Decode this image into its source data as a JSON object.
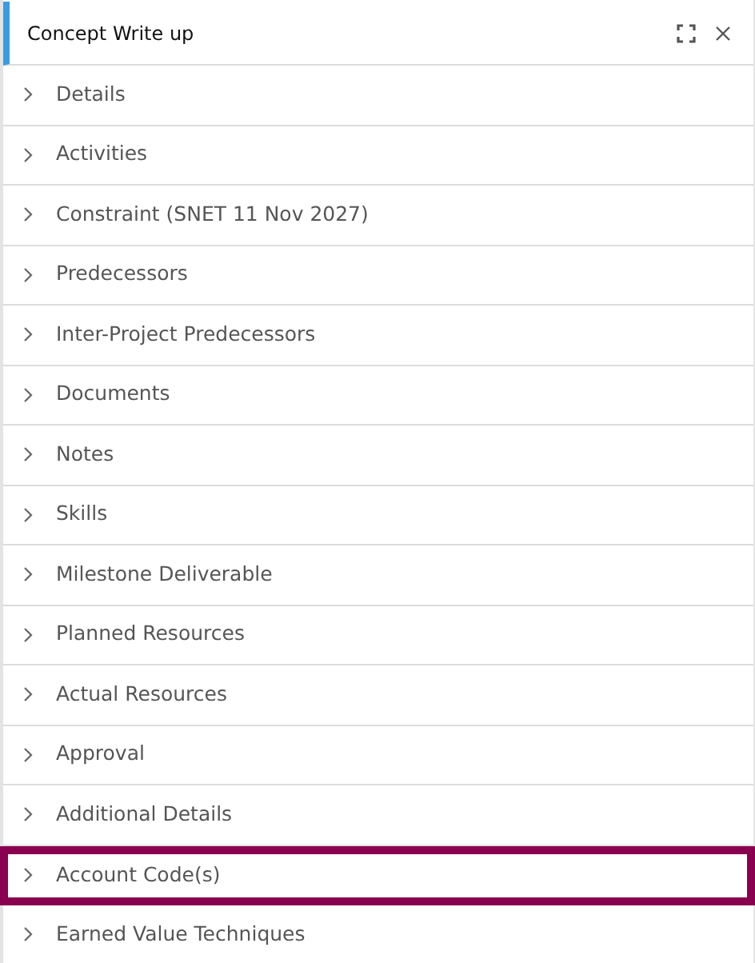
{
  "panel": {
    "title": "Concept Write up"
  },
  "sections": [
    {
      "label": "Details",
      "expanded": false,
      "highlighted": false
    },
    {
      "label": "Activities",
      "expanded": false,
      "highlighted": false
    },
    {
      "label": "Constraint (SNET 11 Nov 2027)",
      "expanded": false,
      "highlighted": false
    },
    {
      "label": "Predecessors",
      "expanded": false,
      "highlighted": false
    },
    {
      "label": "Inter-Project Predecessors",
      "expanded": false,
      "highlighted": false
    },
    {
      "label": "Documents",
      "expanded": false,
      "highlighted": false
    },
    {
      "label": "Notes",
      "expanded": false,
      "highlighted": false
    },
    {
      "label": "Skills",
      "expanded": false,
      "highlighted": false
    },
    {
      "label": "Milestone Deliverable",
      "expanded": false,
      "highlighted": false
    },
    {
      "label": "Planned Resources",
      "expanded": false,
      "highlighted": false
    },
    {
      "label": "Actual Resources",
      "expanded": false,
      "highlighted": false
    },
    {
      "label": "Approval",
      "expanded": false,
      "highlighted": false
    },
    {
      "label": "Additional Details",
      "expanded": false,
      "highlighted": false
    },
    {
      "label": "Account Code(s)",
      "expanded": false,
      "highlighted": true
    },
    {
      "label": "Earned Value Techniques",
      "expanded": false,
      "highlighted": false
    }
  ]
}
